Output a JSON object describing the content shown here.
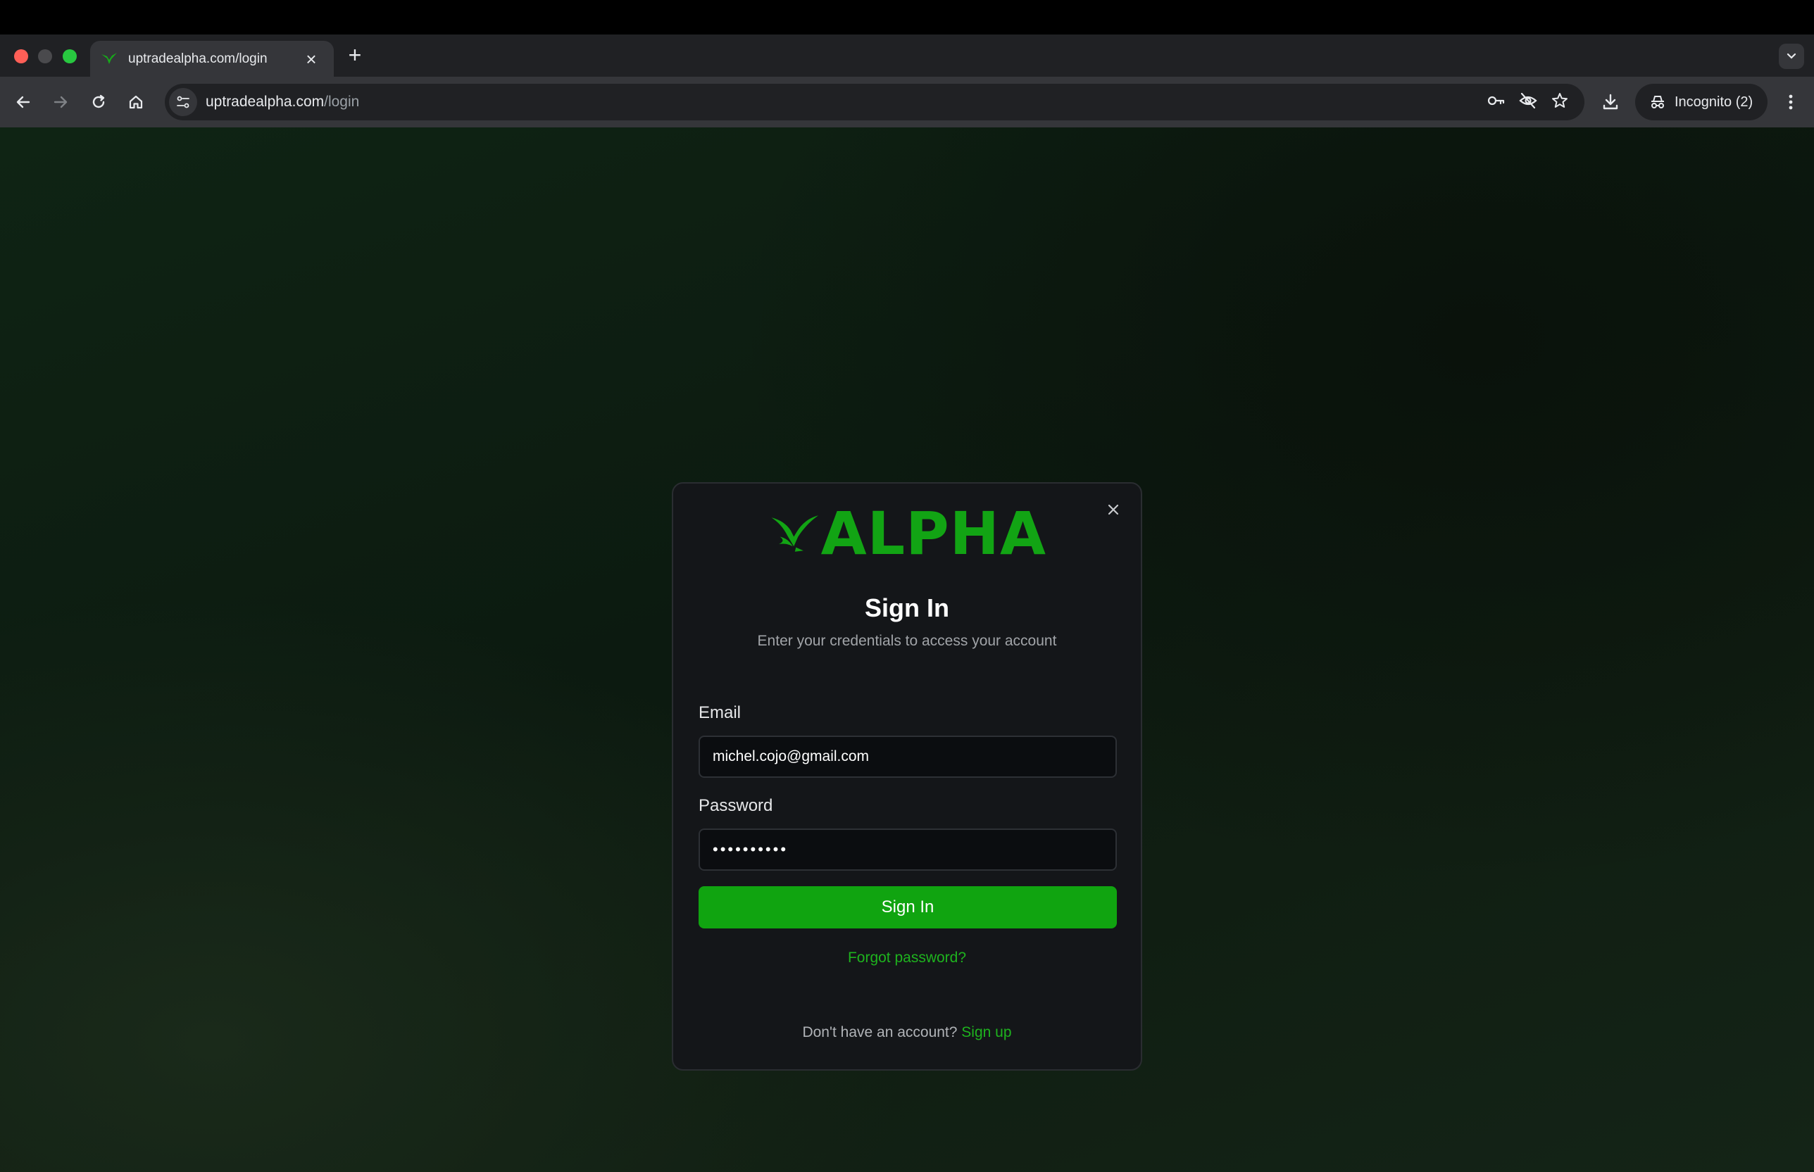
{
  "browser": {
    "tab_title": "uptradealpha.com/login",
    "url_domain": "uptradealpha.com",
    "url_path": "/login",
    "incognito_label": "Incognito (2)",
    "icons": {
      "back": "back-arrow-icon",
      "forward": "forward-arrow-icon",
      "reload": "reload-icon",
      "home": "home-icon",
      "site_info": "site-settings-icon",
      "passwords": "key-icon",
      "tracking": "eye-off-icon",
      "bookmark": "star-icon",
      "downloads": "download-icon",
      "menu": "kebab-menu-icon"
    }
  },
  "login": {
    "brand": "ALPHA",
    "title": "Sign In",
    "subtitle": "Enter your credentials to access your account",
    "email_label": "Email",
    "email_value": "michel.cojo@gmail.com",
    "password_label": "Password",
    "password_value": "••••••••••",
    "submit_label": "Sign In",
    "forgot_label": "Forgot password?",
    "no_account_text": "Don't have an account?",
    "signup_label": "Sign up"
  },
  "colors": {
    "accent": "#10a410",
    "link": "#1eb31e",
    "modal_bg": "#141619"
  }
}
